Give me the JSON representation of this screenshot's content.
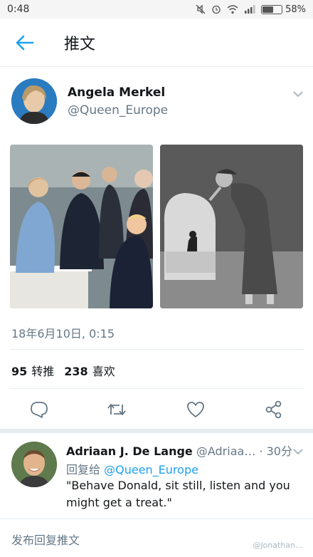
{
  "status_bar": {
    "time": "0:48",
    "battery": "58%",
    "battery_level": 0.58
  },
  "header": {
    "title": "推文"
  },
  "tweet": {
    "author_name": "Angela Merkel",
    "author_handle": "@Queen_Europe",
    "timestamp": "18年6月10日, 0:15",
    "retweets_count": "95",
    "retweets_label": "转推",
    "likes_count": "238",
    "likes_label": "喜欢"
  },
  "reply": {
    "name": "Adriaan J. De Lange",
    "handle": "@Adriaa…",
    "time": "· 30分",
    "reply_to_prefix": "回复给",
    "reply_to_mention": "@Queen_Europe",
    "text": "\"Behave Donald, sit still, listen and you might get a treat.\""
  },
  "compose": {
    "placeholder": "发布回复推文"
  },
  "watermark": "@Jonathan…",
  "colors": {
    "accent": "#1da1f2",
    "secondary_text": "#657786",
    "divider": "#e6ecf0"
  },
  "icons": [
    "back-arrow-icon",
    "caret-down-icon",
    "reply-icon",
    "retweet-icon",
    "like-icon",
    "share-icon"
  ]
}
